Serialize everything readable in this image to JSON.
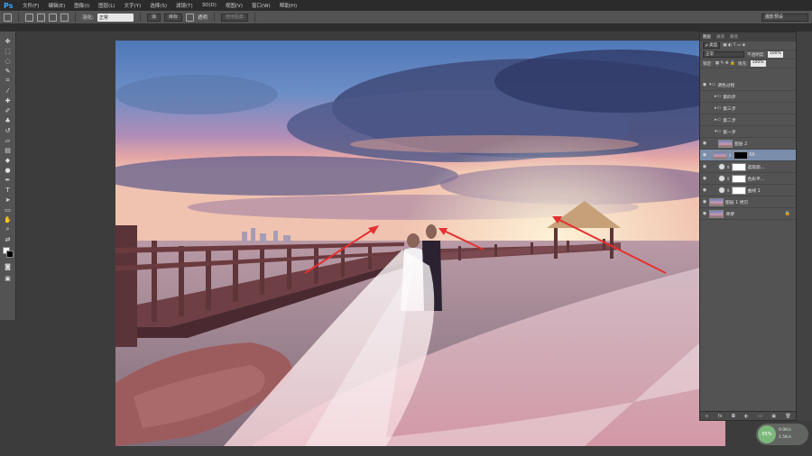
{
  "menubar": {
    "logo": "Ps",
    "items": [
      "文件(F)",
      "编辑(E)",
      "图像(I)",
      "图层(L)",
      "文字(Y)",
      "选择(S)",
      "滤镜(T)",
      "3D(D)",
      "视图(V)",
      "窗口(W)",
      "帮助(H)"
    ]
  },
  "options": {
    "feather_label": "羽化:",
    "mode_value": "正常",
    "btn1": "消",
    "btn2": "目标",
    "transparent_label": "透明",
    "use_pattern": "使用图案",
    "workspace": "摄影预设"
  },
  "layers_panel": {
    "tabs": [
      "图层",
      "通道",
      "路径"
    ],
    "kind_label": "ρ 类型",
    "blend_mode": "正常",
    "opacity_label": "不透明度:",
    "opacity_value": "100%",
    "lock_label": "锁定:",
    "fill_label": "填充:",
    "fill_value": "100%",
    "layers": [
      {
        "name": "调色过程",
        "type": "group",
        "visible": true
      },
      {
        "name": "第四步",
        "type": "group",
        "visible": false
      },
      {
        "name": "第三步",
        "type": "group",
        "visible": false
      },
      {
        "name": "第二步",
        "type": "group",
        "visible": false
      },
      {
        "name": "第一步",
        "type": "group",
        "visible": false
      },
      {
        "name": "图层 2",
        "type": "layer",
        "visible": true
      },
      {
        "name": "66",
        "type": "layer",
        "visible": true,
        "selected": true
      },
      {
        "name": "选取颜...",
        "type": "adjustment",
        "visible": true
      },
      {
        "name": "色彩平...",
        "type": "adjustment",
        "visible": true
      },
      {
        "name": "曲线 1",
        "type": "adjustment",
        "visible": true
      },
      {
        "name": "图层 1 拷贝",
        "type": "layer",
        "visible": true
      },
      {
        "name": "背景",
        "type": "background",
        "visible": true
      }
    ]
  },
  "speed_widget": {
    "percent": "65%",
    "up": "0.0K/s",
    "down": "1.5K/s"
  },
  "colors": {
    "selected_layer": "#7a8eab",
    "arrow": "#e53030"
  }
}
